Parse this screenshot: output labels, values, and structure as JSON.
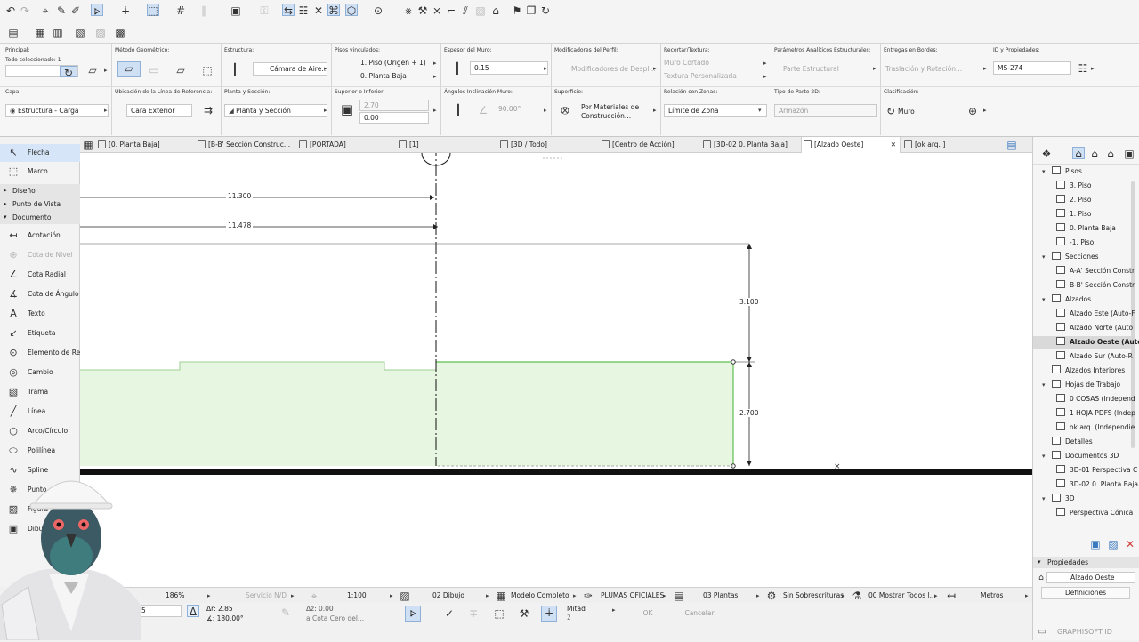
{
  "info_box": {
    "principal_label": "Principal:",
    "principal_value": "Todo seleccionado: 1",
    "metodo_label": "Método Geométrico:",
    "estructura_label": "Estructura:",
    "estructura_value": "Cámara de Aire...",
    "pisos_label": "Pisos vinculados:",
    "piso_top": "1. Piso (Origen + 1)",
    "piso_bottom": "0. Planta Baja",
    "espesor_label": "Espesor del Muro:",
    "espesor_value": "0.15",
    "modificadores_label": "Modificadores del Perfil:",
    "modificadores_value": "Modificadores de Despl...",
    "recortar_label": "Recortar/Textura:",
    "recortar_value1": "Muro Cortado",
    "recortar_value2": "Textura Personalizada",
    "analiticos_label": "Parámetros Analíticos Estructurales:",
    "analiticos_value": "Parte Estructural",
    "entregas_label": "Entregas en Bordes:",
    "entregas_value": "Traslación y Rotación...",
    "id_label": "ID y Propiedades:",
    "id_value": "MS-274",
    "capa_label": "Capa:",
    "capa_value": "Estructura - Carga",
    "ubicacion_label": "Ubicación de la Línea de Referencia:",
    "ubicacion_value": "Cara Exterior",
    "planta_label": "Planta y Sección:",
    "planta_value": "Planta y Sección",
    "superior_label": "Superior e Inferior:",
    "superior_value": "2.70",
    "inferior_value": "0.00",
    "angulos_label": "Ángulos Inclinación Muro:",
    "angulo_value": "90.00°",
    "superficie_label": "Superficie:",
    "superficie_value1": "Por Materiales de",
    "superficie_value2": "Construcción...",
    "relacion_label": "Relación con Zonas:",
    "relacion_value": "Límite de Zona",
    "tipo_label": "Tipo de Parte 2D:",
    "tipo_value": "Armazón",
    "clasificacion_label": "Clasificación:",
    "clasificacion_value": "Muro"
  },
  "tabs": [
    "[0. Planta Baja]",
    "[B-B' Sección Construc...",
    "[PORTADA]",
    "[1]",
    "[3D / Todo]",
    "[Centro de Acción]",
    "[3D-02 0. Planta Baja]",
    "[Alzado Oeste]",
    "[ok arq. ]"
  ],
  "toolbox": {
    "tools_top": [
      "Flecha",
      "Marco"
    ],
    "groups": [
      "Diseño",
      "Punto de Vista",
      "Documento"
    ],
    "tools_doc": [
      "Acotación",
      "Cota de Nivel",
      "Cota Radial",
      "Cota de Ángulo",
      "Texto",
      "Etiqueta",
      "Elemento de Red",
      "Cambio",
      "Trama",
      "Línea",
      "Arco/Círculo",
      "Polilínea",
      "Spline",
      "Punto",
      "Figura",
      "Dibujo"
    ]
  },
  "drawing": {
    "dim_11300": "11.300",
    "dim_11478": "11.478",
    "dim_3100": "3.100",
    "dim_2700": "2.700"
  },
  "navigator": {
    "items": [
      "Pisos",
      "3. Piso",
      "2. Piso",
      "1. Piso",
      "0. Planta Baja",
      "-1. Piso",
      "Secciones",
      "A-A' Sección Constr",
      "B-B' Sección Constr",
      "Alzados",
      "Alzado Este (Auto-F",
      "Alzado Norte (Auto",
      "Alzado Oeste (Auto",
      "Alzado Sur (Auto-R",
      "Alzados Interiores",
      "Hojas de Trabajo",
      "0 COSAS (Independ",
      "1 HOJA PDFS (Indep",
      "ok arq. (Independie",
      "Detalles",
      "Documentos 3D",
      "3D-01 Perspectiva C",
      "3D-02 0. Planta Baja",
      "3D",
      "Perspectiva Cónica"
    ],
    "properties_label": "Propiedades",
    "properties_value": "Alzado Oeste",
    "definiciones": "Definiciones"
  },
  "status_bar": {
    "zoom": "186%",
    "servicio": "Servicio N/D",
    "escala": "1:100",
    "dibujo": "02 Dibujo",
    "modelo": "Modelo Completo",
    "plumas": "PLUMAS OFICIALES",
    "plantas": "03 Plantas",
    "sobrescrituras": "Sin Sobrescrituras",
    "mostrar": "00 Mostrar Todos l...",
    "unidades": "Metros"
  },
  "command_bar": {
    "coord1": "5",
    "dr": "Δr: 2.85",
    "angle": "∡: 180.00°",
    "dz": "Δz: 0.00",
    "cota": "a Cota Cero del...",
    "mitad": "Mitad",
    "mitad_n": "2",
    "ok": "OK",
    "cancel": "Cancelar"
  },
  "footer": {
    "brand": "GRAPHISOFT ID"
  }
}
